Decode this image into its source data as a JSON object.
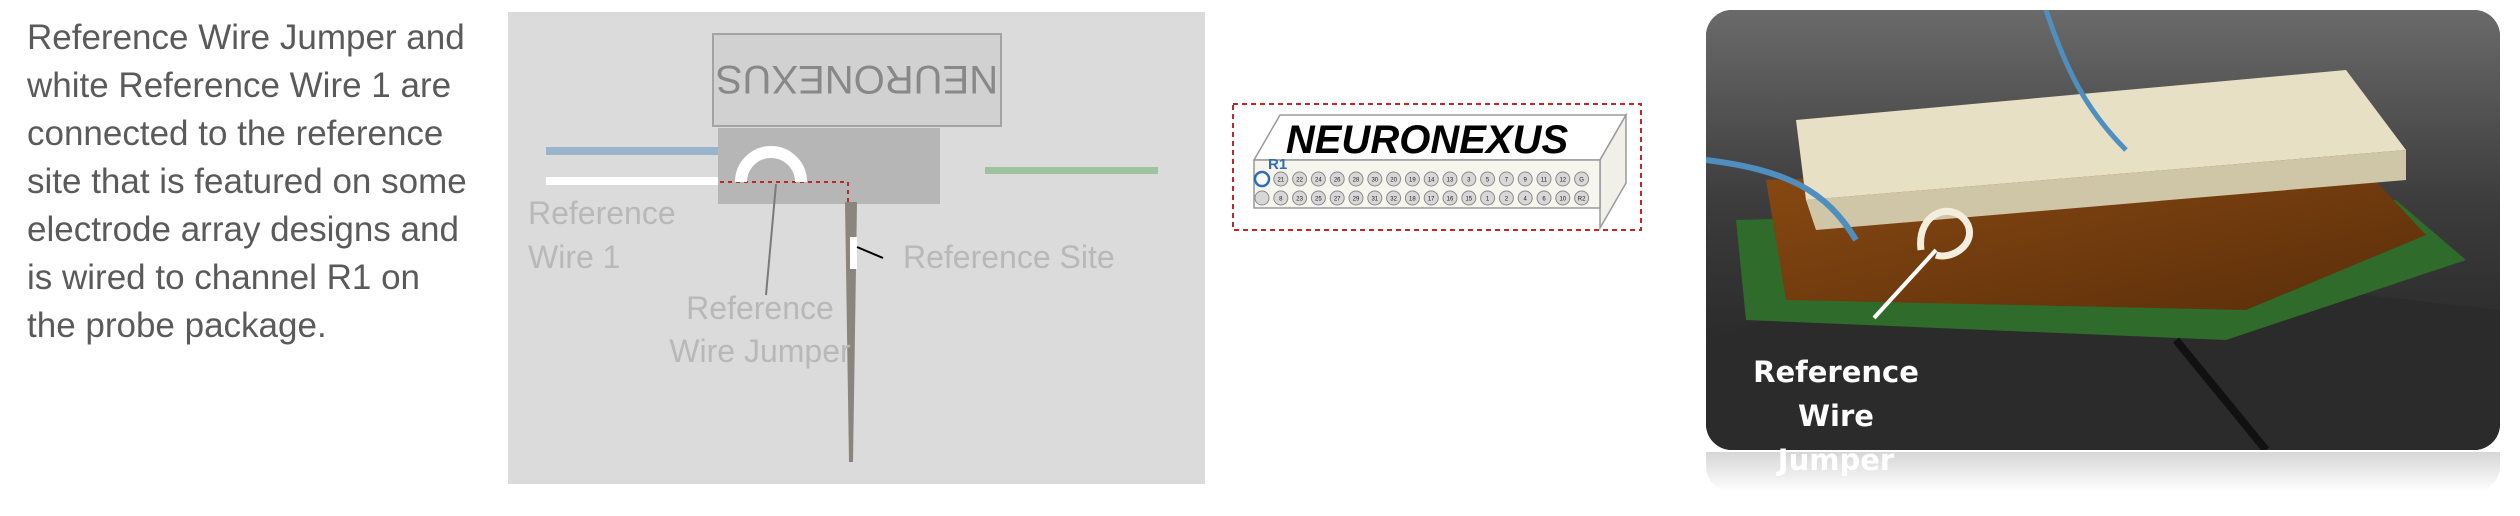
{
  "description": "Reference Wire Jumper and\nwhite Reference Wire 1 are\nconnected to the reference\nsite that is featured on some\nelectrode array designs and\nis wired to channel R1 on\nthe probe package.",
  "diagram": {
    "connector_brand": "NEURONEXUS",
    "labels": {
      "reference_wire_1_line1": "Reference",
      "reference_wire_1_line2": "Wire 1",
      "reference_wire_jumper_line1": "Reference",
      "reference_wire_jumper_line2": "Wire Jumper",
      "reference_site": "Reference Site"
    }
  },
  "connector_header": {
    "brand": "NEURONEXUS",
    "channel_label": "R1",
    "top_row": [
      "R1",
      "21",
      "22",
      "24",
      "26",
      "28",
      "30",
      "20",
      "19",
      "14",
      "13",
      "3",
      "5",
      "7",
      "9",
      "11",
      "12",
      "G"
    ],
    "bottom_row": [
      "",
      "8",
      "23",
      "25",
      "27",
      "29",
      "31",
      "32",
      "18",
      "17",
      "16",
      "15",
      "1",
      "2",
      "4",
      "6",
      "10",
      "R2"
    ],
    "accent_color": "#2e6eb5",
    "border_color": "#c0272d"
  },
  "photo": {
    "caption": "Reference\nWire Jumper"
  }
}
